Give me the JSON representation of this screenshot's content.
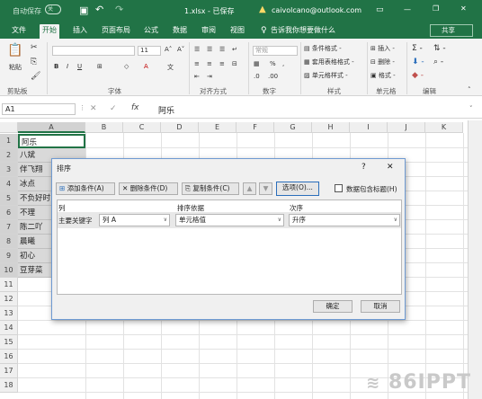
{
  "title_bar": {
    "autosave": "自动保存",
    "autosave_state": "关",
    "filename": "1.xlsx - 已保存",
    "account": "caivolcano@outlook.com",
    "minimize": "—",
    "restore": "❐",
    "close": "✕"
  },
  "menu": {
    "tabs": [
      "文件",
      "开始",
      "插入",
      "页面布局",
      "公式",
      "数据",
      "审阅",
      "视图"
    ],
    "tell_me": "告诉我你想要做什么",
    "share": "共享"
  },
  "ribbon": {
    "paste": "粘贴",
    "clipboard": "剪贴板",
    "font": "字体",
    "font_size": "11",
    "alignment": "对齐方式",
    "number_format": "常规",
    "number": "数字",
    "cond_format": "条件格式 -",
    "table_format": "套用表格格式 -",
    "cell_style": "单元格样式 -",
    "styles": "样式",
    "insert": "插入 -",
    "delete": "删除 -",
    "format": "格式 -",
    "cells": "单元格",
    "editing": "编辑"
  },
  "formula_bar": {
    "name_box": "A1",
    "fx": "fx",
    "value": "阿乐"
  },
  "columns": [
    "A",
    "B",
    "C",
    "D",
    "E",
    "F",
    "G",
    "H",
    "I",
    "J",
    "K"
  ],
  "rows": [
    "1",
    "2",
    "3",
    "4",
    "5",
    "6",
    "7",
    "8",
    "9",
    "10",
    "11",
    "12",
    "13",
    "14",
    "15",
    "16",
    "17",
    "18"
  ],
  "cells_a": [
    "阿乐",
    "八斌",
    "伴飞翔",
    "冰点",
    "不负好时",
    "不理",
    "陈二吖",
    "晨曦",
    "初心",
    "豆芽菜"
  ],
  "dialog": {
    "title": "排序",
    "help": "?",
    "close": "✕",
    "add_condition": "添加条件(A)",
    "delete_condition": "删除条件(D)",
    "copy_condition": "复制条件(C)",
    "up": "▲",
    "down": "▼",
    "options": "选项(O)...",
    "has_header": "数据包含标题(H)",
    "col_header": "列",
    "sort_on_header": "排序依据",
    "order_header": "次序",
    "primary_key_label": "主要关键字",
    "primary_key_value": "列 A",
    "sort_on_value": "单元格值",
    "order_value": "升序",
    "ok": "确定",
    "cancel": "取消"
  },
  "watermark": "86IPPT",
  "colors": {
    "accent": "#217346",
    "dialog_border": "#6e9ad2"
  }
}
